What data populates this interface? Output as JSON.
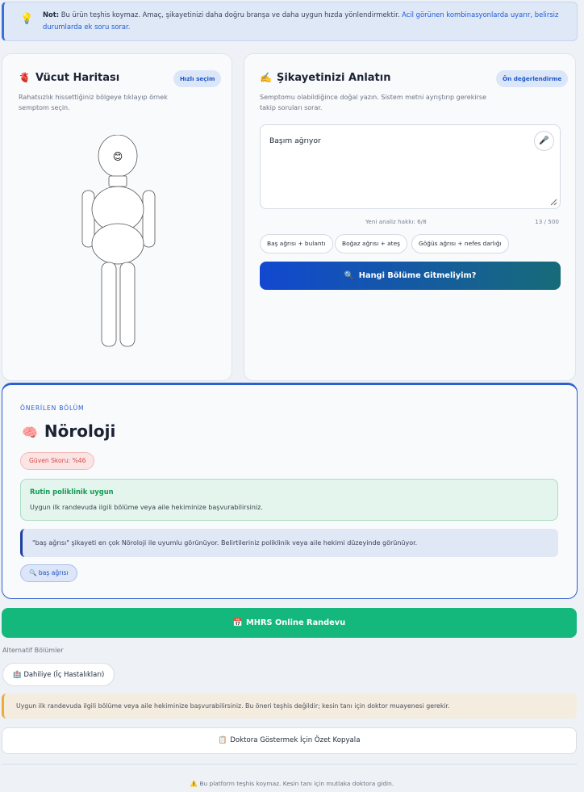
{
  "notice": {
    "prefix": "Not:",
    "text": "Bu ürün teşhis koymaz. Amaç, şikayetinizi daha doğru branşa ve daha uygun hızda yönlendirmektir.",
    "link": "Acil görünen kombinasyonlarda uyarır, belirsiz durumlarda ek soru sorar.",
    "icon": "lightbulb-icon"
  },
  "body_map": {
    "title": "Vücut Haritası",
    "title_icon": "anatomical-heart-icon",
    "quick_button": "Hızlı seçim",
    "description": "Rahatsızlık hissettiğiniz bölgeye tıklayıp örnek semptom seçin.",
    "face_emoji": "😊"
  },
  "complaint": {
    "title": "Şikayetinizi Anlatın",
    "title_icon": "writing-hand-icon",
    "pre_eval_button": "Ön değerlendirme",
    "description": "Semptomu olabildiğince doğal yazın. Sistem metni ayrıştırıp gerekirse takip soruları sorar.",
    "input_value": "Başım ağrıyor",
    "analysis_quota": "Yeni analiz hakkı: 6/8",
    "char_count": "13 / 500",
    "chips": [
      "Baş ağrısı + bulantı",
      "Boğaz ağrısı + ateş",
      "Göğüs ağrısı + nefes darlığı"
    ],
    "submit_label": "Hangi Bölüme Gitmeliyim?",
    "submit_icon": "magnifier-icon"
  },
  "result": {
    "section_label": "ÖNERİLEN BÖLÜM",
    "department": "Nöroloji",
    "department_icon": "brain-icon",
    "confidence": "Güven Skoru: %46",
    "urgency_title": "Rutin poliklinik uygun",
    "urgency_text": "Uygun ilk randevuda ilgili bölüme veya aile hekiminize başvurabilirsiniz.",
    "explanation": "\"baş ağrısı\" şikayeti en çok Nöroloji ile uyumlu görünüyor. Belirtileriniz poliklinik veya aile hekimi düzeyinde görünüyor.",
    "matched_tag": "baş ağrısı"
  },
  "mhrs_button": "MHRS Online Randevu",
  "alternatives": {
    "label": "Alternatif Bölümler",
    "items": [
      "Dahiliye (İç Hastalıkları)"
    ]
  },
  "warning": "Uygun ilk randevuda ilgili bölüme veya aile hekiminize başvurabilirsiniz. Bu öneri teşhis değildir; kesin tanı için doktor muayenesi gerekir.",
  "copy_button": "Doktora Göstermek İçin Özet Kopyala",
  "footer": "Bu platform teşhis koymaz. Kesin tanı için mutlaka doktora gidin.",
  "colors": {
    "primary": "#1248d0",
    "teal": "#176b78",
    "success": "#14b87c",
    "danger": "#d84848",
    "warning": "#f0a93a"
  }
}
